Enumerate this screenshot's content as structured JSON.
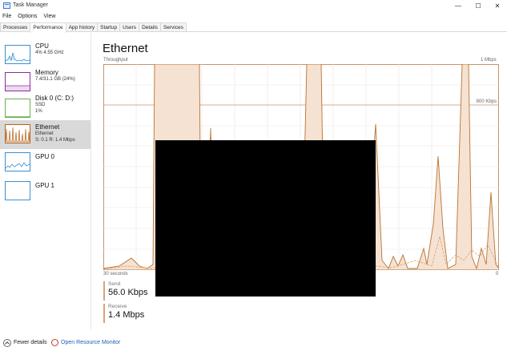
{
  "window": {
    "title": "Task Manager",
    "minimize_glyph": "—",
    "maximize_glyph": "☐",
    "close_glyph": "✕"
  },
  "menu": [
    "File",
    "Options",
    "View"
  ],
  "tabs": [
    "Processes",
    "Performance",
    "App history",
    "Startup",
    "Users",
    "Details",
    "Services"
  ],
  "active_tab": "Performance",
  "sidebar": {
    "cpu": {
      "name": "CPU",
      "detail": "4% 4.55 GHz",
      "color": "#3a8fd0"
    },
    "memory": {
      "name": "Memory",
      "detail": "7.4/31.1 GB (24%)",
      "color": "#8b2f9b"
    },
    "disk": {
      "name": "Disk 0 (C: D:)",
      "detail1": "SSD",
      "detail2": "1%",
      "color": "#6ab04c"
    },
    "ethernet": {
      "name": "Ethernet",
      "detail1": "Ethernet",
      "detail2": "S: 0.1 R: 1.4 Mbps",
      "color": "#b5651d"
    },
    "gpu0": {
      "name": "GPU 0",
      "color": "#3a8fd0"
    },
    "gpu1": {
      "name": "GPU 1",
      "color": "#3a8fd0"
    }
  },
  "main": {
    "title": "Ethernet",
    "throughput_label": "Throughput",
    "max_label": "1 Mbps",
    "mid_label": "800 Kbps",
    "time_left": "30 seconds",
    "time_right": "0"
  },
  "stats": {
    "send_label": "Send",
    "send_value": "56.0 Kbps",
    "receive_label": "Receive",
    "receive_value": "1.4 Mbps"
  },
  "footer": {
    "fewer_details": "Fewer details",
    "open_resource_monitor": "Open Resource Monitor"
  },
  "colors": {
    "graph_line": "#b87333",
    "graph_fill": "#f6e2d2",
    "graph_border": "#c8956a",
    "grid": "#efe3da",
    "link": "#1f5eb5"
  }
}
